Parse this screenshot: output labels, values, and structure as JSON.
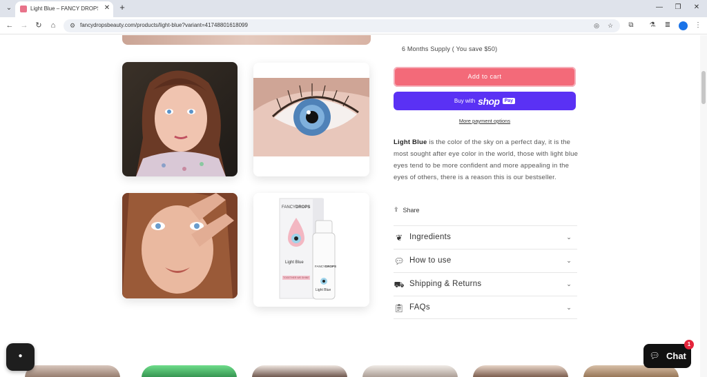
{
  "browser": {
    "tab_title": "Light Blue – FANCY DROPS BE/",
    "url": "fancydropsbeauty.com/products/light-blue?variant=41748801618099"
  },
  "product": {
    "supply_option": "6 Months Supply ( You save $50)",
    "add_to_cart": "Add to cart",
    "buy_with": "Buy with",
    "shop_logo": "shop",
    "shop_pay_badge": "Pay",
    "more_payment_options": "More payment options",
    "description_name": "Light Blue",
    "description_text": " is the color of the sky on a perfect day, it is the most sought after eye color in the world, those with light blue eyes tend to be more confident and more appealing in the eyes of others, there is a reason this is our bestseller.",
    "share_label": "Share"
  },
  "packaging": {
    "brand_a": "FANCY",
    "brand_b": "DROPS",
    "box_label": "Light Blue",
    "tagline": "TOGETHER WE SHINE",
    "bottle_label": "Light Blue"
  },
  "accordion": [
    {
      "label": "Ingredients",
      "icon": "leaf-icon"
    },
    {
      "label": "How to use",
      "icon": "chat-bubble-icon"
    },
    {
      "label": "Shipping & Returns",
      "icon": "truck-icon"
    },
    {
      "label": "FAQs",
      "icon": "clipboard-icon"
    }
  ],
  "chat": {
    "label": "Chat",
    "badge": "1"
  },
  "colors": {
    "add_to_cart": "#f36a79",
    "shop_pay": "#5a31f4",
    "chat": "#111111"
  }
}
